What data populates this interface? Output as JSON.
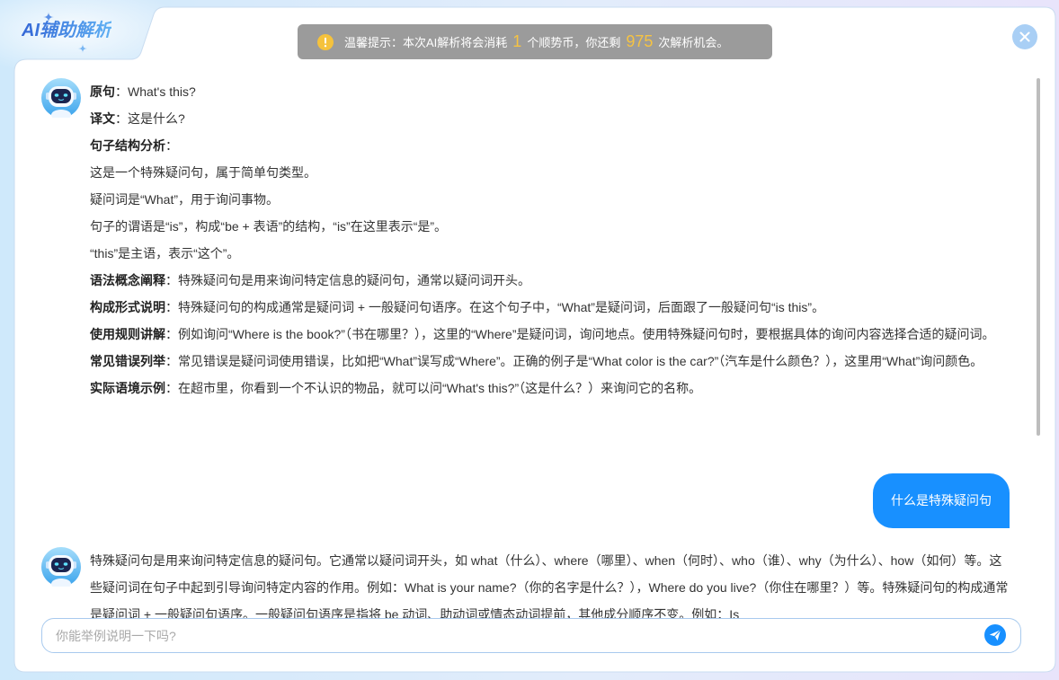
{
  "window": {
    "title": "AI辅助解析"
  },
  "notice": {
    "text_before": "温馨提示：本次AI解析将会消耗",
    "cost": "1",
    "text_middle": "个顺势币，你还剩",
    "remaining": "975",
    "text_after": "次解析机会。"
  },
  "colon": "：",
  "conversation": {
    "ai_reply_1": {
      "sentence": {
        "label": "原句",
        "text": "What's this?"
      },
      "translation": {
        "label": "译文",
        "text": "这是什么?"
      },
      "structure": {
        "label": "句子结构分析",
        "points": [
          "这是一个特殊疑问句，属于简单句类型。",
          "疑问词是“What”，用于询问事物。",
          "句子的谓语是“is”，构成“be + 表语”的结构，“is”在这里表示“是”。",
          "“this”是主语，表示“这个”。"
        ]
      },
      "grammar": {
        "label": "语法概念阐释",
        "text": "特殊疑问句是用来询问特定信息的疑问句，通常以疑问词开头。"
      },
      "form": {
        "label": "构成形式说明",
        "text": "特殊疑问句的构成通常是疑问词 + 一般疑问句语序。在这个句子中，“What”是疑问词，后面跟了一般疑问句“is this”。"
      },
      "usage": {
        "label": "使用规则讲解",
        "text": "例如询问“Where is the book?”（书在哪里？），这里的“Where”是疑问词，询问地点。使用特殊疑问句时，要根据具体的询问内容选择合适的疑问词。"
      },
      "errors": {
        "label": "常见错误列举",
        "text": "常见错误是疑问词使用错误，比如把“What”误写成“Where”。正确的例子是“What color is the car?”（汽车是什么颜色？），这里用“What”询问颜色。"
      },
      "example": {
        "label": "实际语境示例",
        "text": "在超市里，你看到一个不认识的物品，就可以问“What's this?”（这是什么？）来询问它的名称。"
      }
    },
    "user_message": {
      "text": "什么是特殊疑问句"
    },
    "ai_reply_2": {
      "text": "特殊疑问句是用来询问特定信息的疑问句。它通常以疑问词开头，如 what（什么）、where（哪里）、when（何时）、who（谁）、why（为什么）、how（如何）等。这些疑问词在句子中起到引导询问特定内容的作用。例如：What is your name?（你的名字是什么？），Where do you live?（你住在哪里？）等。特殊疑问句的构成通常是疑问词 + 一般疑问句语序。一般疑问句语序是指将 be 动词、助动词或情态动词提前，其他成分顺序不变。例如：Is"
    }
  },
  "composer": {
    "placeholder": "你能举例说明一下吗?"
  },
  "icons": {
    "title_decoration": "sparkle-icon",
    "notice": "warning-icon",
    "close": "close-icon",
    "avatar": "robot-avatar-icon",
    "send": "send-icon"
  },
  "colors": {
    "accent": "#1890ff",
    "notice_bg": "#9b9b9b",
    "highlight": "#f6c342",
    "close_bg": "#a9cff5",
    "panel_border": "#c9dcf0",
    "title_start": "#3467d6",
    "title_end": "#5fb0f3"
  }
}
